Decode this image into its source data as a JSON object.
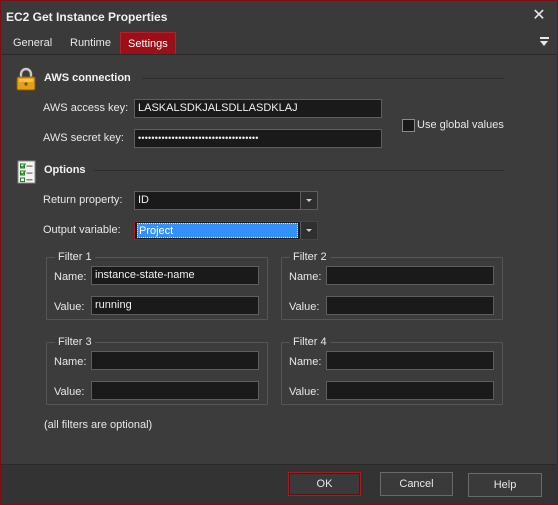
{
  "window": {
    "title": "EC2 Get Instance Properties",
    "accent_color": "#9b1018"
  },
  "tabs": [
    {
      "label": "General",
      "active": false
    },
    {
      "label": "Runtime",
      "active": false
    },
    {
      "label": "Settings",
      "active": true
    }
  ],
  "aws": {
    "section_title": "AWS connection",
    "icon": "padlock-icon",
    "access_key_label": "AWS access key:",
    "access_key_value": "LASKALSDKJALSDLLASDKLAJ",
    "secret_key_label": "AWS secret key:",
    "secret_key_value": "••••••••••••••••••••••••••••••••••••",
    "use_global_label": "Use global values",
    "use_global_checked": false
  },
  "options": {
    "section_title": "Options",
    "icon": "checklist-icon",
    "return_property_label": "Return property:",
    "return_property_value": "ID",
    "output_variable_label": "Output variable:",
    "output_variable_value": "Project"
  },
  "filters": [
    {
      "title": "Filter 1",
      "name_label": "Name:",
      "name_value": "instance-state-name",
      "value_label": "Value:",
      "value_value": "running"
    },
    {
      "title": "Filter 2",
      "name_label": "Name:",
      "name_value": "",
      "value_label": "Value:",
      "value_value": ""
    },
    {
      "title": "Filter 3",
      "name_label": "Name:",
      "name_value": "",
      "value_label": "Value:",
      "value_value": ""
    },
    {
      "title": "Filter 4",
      "name_label": "Name:",
      "name_value": "",
      "value_label": "Value:",
      "value_value": ""
    }
  ],
  "filters_note": "(all filters are optional)",
  "buttons": {
    "ok": "OK",
    "cancel": "Cancel",
    "help": "Help"
  }
}
